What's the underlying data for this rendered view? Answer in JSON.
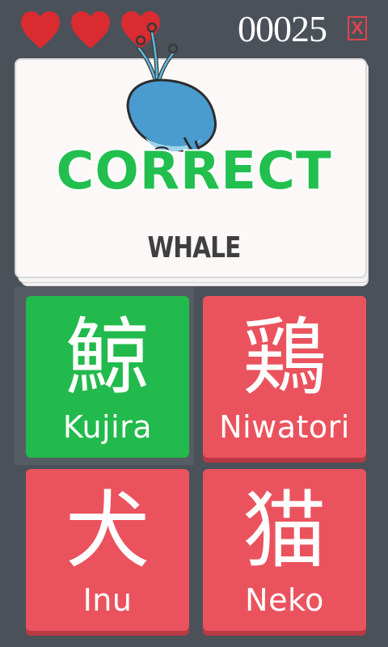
{
  "lives": {
    "count": 3,
    "color": "#d92b30"
  },
  "score": "00025",
  "close_label": "X",
  "card": {
    "image": "whale-icon",
    "feedback": "CORRECT",
    "word": "WHALE"
  },
  "answers": [
    {
      "kanji": "鯨",
      "romaji": "Kujira",
      "state": "correct"
    },
    {
      "kanji": "鶏",
      "romaji": "Niwatori",
      "state": "normal"
    },
    {
      "kanji": "犬",
      "romaji": "Inu",
      "state": "normal"
    },
    {
      "kanji": "猫",
      "romaji": "Neko",
      "state": "normal"
    }
  ],
  "colors": {
    "background": "#4b5159",
    "correct": "#22ba4c",
    "answer": "#ea535e",
    "feedback": "#22bf4f"
  }
}
